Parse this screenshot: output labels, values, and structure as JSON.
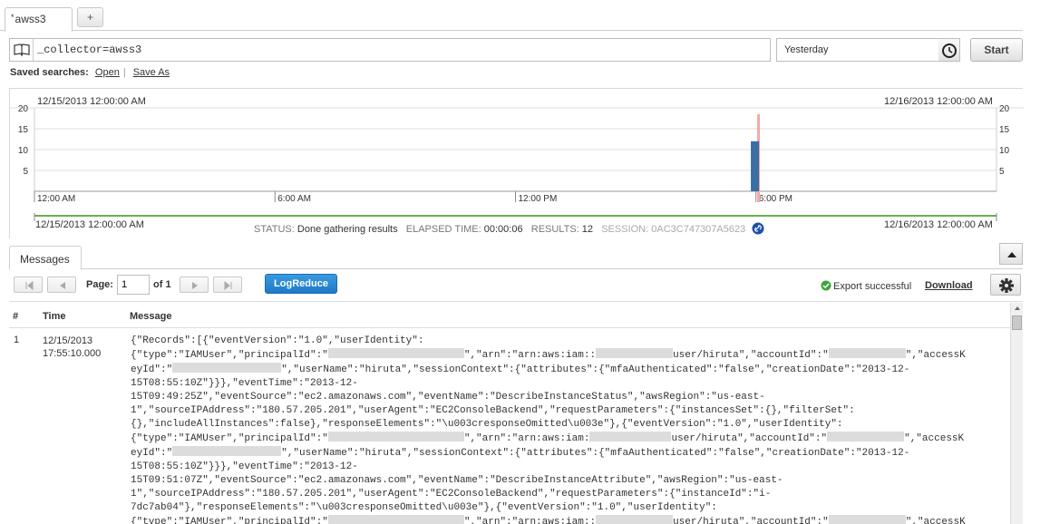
{
  "tabs": [
    {
      "label": "awss3",
      "modified_marker": "*"
    }
  ],
  "tab_add_label": "+",
  "search": {
    "query": "_collector=awss3",
    "time_range": "Yesterday",
    "start_label": "Start"
  },
  "saved_searches": {
    "label": "Saved searches:",
    "open": "Open",
    "sep": "|",
    "save_as": "Save As"
  },
  "histogram": {
    "range_start": "12/15/2013 12:00:00 AM",
    "range_end": "12/16/2013 12:00:00 AM",
    "timeline_start": "12/15/2013 12:00:00 AM",
    "timeline_end": "12/16/2013 12:00:00 AM",
    "colors": {
      "bar": "#3a6ea5",
      "marker": "#f4a8a8",
      "timeline": "#6ab04c",
      "grid": "#dcdcdc"
    }
  },
  "chart_data": {
    "type": "bar",
    "x_ticks": [
      "12:00 AM",
      "6:00 AM",
      "12:00 PM",
      "6:00 PM"
    ],
    "y_ticks": [
      5,
      10,
      15,
      20
    ],
    "ylim": [
      0,
      20
    ],
    "bars": [
      {
        "x": "17:55",
        "value": 12
      }
    ],
    "marker": "17:55"
  },
  "status": {
    "status_label": "STATUS:",
    "status_value": "Done gathering results",
    "elapsed_label": "ELAPSED TIME:",
    "elapsed_value": "00:00:06",
    "results_label": "RESULTS:",
    "results_value": "12",
    "session_label": "SESSION:",
    "session_value": "0AC3C747307A5623"
  },
  "messages": {
    "tab_label": "Messages",
    "page_label": "Page:",
    "page_value": "1",
    "of_label": "of 1",
    "logreduce_label": "LogReduce",
    "export_status": "Export successful",
    "download_label": "Download",
    "columns": {
      "num": "#",
      "time": "Time",
      "message": "Message"
    },
    "rows": [
      {
        "num": "1",
        "time_date": "12/15/2013",
        "time_clock": "17:55:10.000",
        "lines": [
          [
            "{\"Records\":[{\"eventVersion\":\"1.0\",\"userIdentity\":"
          ],
          [
            "{\"type\":\"IAMUser\",\"principalId\":\"",
            "#R150",
            "\",\"arn\":\"arn:aws:iam::",
            "#R85",
            "user/hiruta\",\"accountId\":\"",
            "#R85",
            "\",\"accessK"
          ],
          [
            "eyId\":\"",
            "#R120",
            "\",\"userName\":\"hiruta\",\"sessionContext\":{\"attributes\":{\"mfaAuthenticated\":\"false\",\"creationDate\":\"2013-12-"
          ],
          [
            "15T08:55:10Z\"}}},\"eventTime\":\"2013-12-"
          ],
          [
            "15T09:49:25Z\",\"eventSource\":\"ec2.amazonaws.com\",\"eventName\":\"DescribeInstanceStatus\",\"awsRegion\":\"us-east-"
          ],
          [
            "1\",\"sourceIPAddress\":\"180.57.205.201\",\"userAgent\":\"EC2ConsoleBackend\",\"requestParameters\":{\"instancesSet\":{},\"filterSet\":"
          ],
          [
            "{},\"includeAllInstances\":false},\"responseElements\":\"\\u003cresponseOmitted\\u003e\"},{\"eventVersion\":\"1.0\",\"userIdentity\":"
          ],
          [
            "{\"type\":\"IAMUser\",\"principalId\":\"",
            "#R150",
            "\",\"arn\":\"arn:aws:iam:",
            "#R90",
            "user/hiruta\",\"accountId\":\"",
            "#R85",
            "\",\"accessK"
          ],
          [
            "eyId\":\"",
            "#R120",
            "\",\"userName\":\"hiruta\",\"sessionContext\":{\"attributes\":{\"mfaAuthenticated\":\"false\",\"creationDate\":\"2013-12-"
          ],
          [
            "15T08:55:10Z\"}}},\"eventTime\":\"2013-12-"
          ],
          [
            "15T09:51:07Z\",\"eventSource\":\"ec2.amazonaws.com\",\"eventName\":\"DescribeInstanceAttribute\",\"awsRegion\":\"us-east-"
          ],
          [
            "1\",\"sourceIPAddress\":\"180.57.205.201\",\"userAgent\":\"EC2ConsoleBackend\",\"requestParameters\":{\"instanceId\":\"i-"
          ],
          [
            "7dc7ab04\"},\"responseElements\":\"\\u003cresponseOmitted\\u003e\"},{\"eventVersion\":\"1.0\",\"userIdentity\":"
          ],
          [
            "{\"type\":\"IAMUser\",\"principalId\":\"",
            "#R150",
            "\",\"arn\":\"arn:aws:iam::",
            "#R85",
            "user/hiruta\",\"accountId\":\"",
            "#R85",
            "\",\"accessK"
          ]
        ]
      }
    ]
  }
}
